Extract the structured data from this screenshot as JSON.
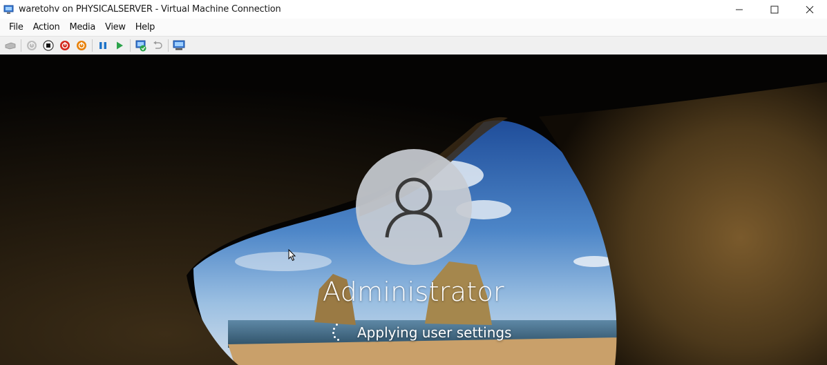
{
  "window": {
    "title": "waretohv on PHYSICALSERVER - Virtual Machine Connection",
    "icon": "vm-connection-icon",
    "controls": [
      "minimize-icon",
      "maximize-icon",
      "close-icon"
    ]
  },
  "menu": {
    "items": [
      {
        "id": "file",
        "label": "File"
      },
      {
        "id": "action",
        "label": "Action"
      },
      {
        "id": "media",
        "label": "Media"
      },
      {
        "id": "view",
        "label": "View"
      },
      {
        "id": "help",
        "label": "Help"
      }
    ]
  },
  "toolbar": {
    "buttons": [
      "ctrl-alt-del-icon",
      "start-icon",
      "turn-off-icon",
      "shutdown-icon",
      "save-icon",
      "pause-icon",
      "resume-icon",
      "checkpoint-icon",
      "revert-icon",
      "enhanced-session-icon"
    ],
    "colors": {
      "red": "#d42a1e",
      "orange": "#e8820c",
      "blue": "#1e73c8",
      "green": "#2ba34a"
    }
  },
  "lockscreen": {
    "user_name": "Administrator",
    "status": "Applying user settings",
    "avatar_icon": "user-icon"
  }
}
